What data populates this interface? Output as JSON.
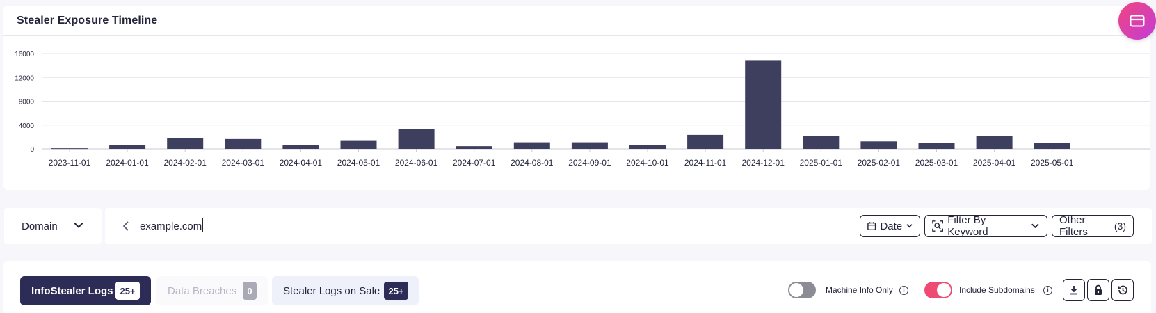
{
  "chart_card": {
    "title": "Stealer Exposure Timeline"
  },
  "chart_data": {
    "type": "bar",
    "title": "Stealer Exposure Timeline",
    "xlabel": "",
    "ylabel": "",
    "ylim": [
      0,
      16000
    ],
    "yticks": [
      0,
      4000,
      8000,
      12000,
      16000
    ],
    "grid": true,
    "categories": [
      "2023-11-01",
      "2024-01-01",
      "2024-02-01",
      "2024-03-01",
      "2024-04-01",
      "2024-05-01",
      "2024-06-01",
      "2024-07-01",
      "2024-08-01",
      "2024-09-01",
      "2024-10-01",
      "2024-11-01",
      "2024-12-01",
      "2025-01-01",
      "2025-02-01",
      "2025-03-01",
      "2025-04-01",
      "2025-05-01"
    ],
    "values": [
      100,
      650,
      1850,
      1650,
      700,
      1450,
      3350,
      450,
      1100,
      1100,
      700,
      2350,
      14900,
      2200,
      1250,
      1050,
      2200,
      1050
    ],
    "color": "#3e3e5f"
  },
  "filters": {
    "domain_select": "Domain",
    "search_value": "example.com",
    "date_label": "Date",
    "keyword_label": "Filter By Keyword",
    "other_filters_label": "Other Filters",
    "other_filters_count": "(3)"
  },
  "tabs": [
    {
      "label": "InfoStealer Logs",
      "badge": "25+"
    },
    {
      "label": "Data Breaches",
      "badge": "0"
    },
    {
      "label": "Stealer Logs on Sale",
      "badge": "25+"
    }
  ],
  "toggles": {
    "machine_info_label": "Machine Info Only",
    "include_subdomains_label": "Include Subdomains"
  },
  "icons": {
    "fab": "card-icon",
    "download": "download-icon",
    "lock": "lock-icon",
    "history": "history-icon"
  },
  "colors": {
    "accent": "#2c2c57",
    "toggle_on": "#ef4a72",
    "fab_gradient_start": "#f0457f",
    "fab_gradient_end": "#c43cd8"
  }
}
